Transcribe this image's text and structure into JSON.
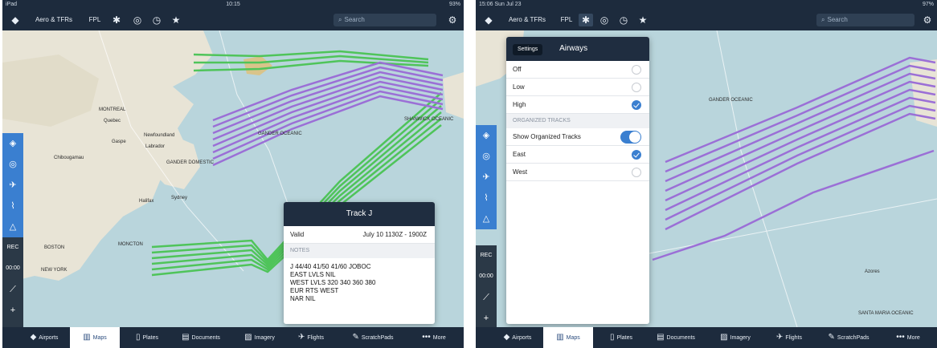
{
  "left": {
    "status": {
      "left": "iPad",
      "time": "10:15",
      "right": "93%"
    },
    "toolbar": {
      "layer_label": "Aero & TFRs",
      "fpl_label": "FPL",
      "search_placeholder": "Search"
    },
    "map_labels": [
      "MONTREAL",
      "Quebec",
      "Newfoundland",
      "Labrador",
      "GANDER DOMESTIC",
      "GANDER OCEANIC",
      "SHANWICK OCEANIC",
      "MONCTON",
      "BOSTON",
      "NEW YORK",
      "Chibougamau",
      "Gaspe",
      "Sydney",
      "Halifax"
    ],
    "side_labels": {
      "rec": "REC",
      "timer": "00:00"
    },
    "popup": {
      "title": "Track J",
      "valid_label": "Valid",
      "valid_value": "July 10 1130Z - 1900Z",
      "notes_header": "NOTES",
      "notes": [
        "J 44/40 41/50 41/60 JOBOC",
        "EAST LVLS NIL",
        "WEST LVLS 320 340 360 380",
        "EUR RTS WEST",
        "NAR NIL"
      ]
    },
    "tabs": [
      "Airports",
      "Maps",
      "Plates",
      "Documents",
      "Imagery",
      "Flights",
      "ScratchPads",
      "More"
    ],
    "active_tab": "Maps"
  },
  "right": {
    "status": {
      "left": "15:06 Sun Jul 23",
      "right": "97%"
    },
    "toolbar": {
      "layer_label": "Aero & TFRs",
      "fpl_label": "FPL",
      "search_placeholder": "Search"
    },
    "map_labels": [
      "GANDER OCEANIC",
      "SANTA MARIA OCEANIC",
      "Azores"
    ],
    "side_labels": {
      "rec": "REC",
      "timer": "00:00"
    },
    "settings": {
      "back_label": "Settings",
      "title": "Airways",
      "options": [
        {
          "label": "Off",
          "selected": false
        },
        {
          "label": "Low",
          "selected": false
        },
        {
          "label": "High",
          "selected": true
        }
      ],
      "tracks_header": "ORGANIZED TRACKS",
      "show_tracks_label": "Show Organized Tracks",
      "show_tracks_on": true,
      "directions": [
        {
          "label": "East",
          "selected": true
        },
        {
          "label": "West",
          "selected": false
        }
      ]
    },
    "tabs": [
      "Airports",
      "Maps",
      "Plates",
      "Documents",
      "Imagery",
      "Flights",
      "ScratchPads",
      "More"
    ],
    "active_tab": "Maps"
  },
  "colors": {
    "nav": "#1d2b3d",
    "accent": "#3a7fd0",
    "track_east": "#9b6fd6",
    "track_west": "#4fc45a",
    "ocean": "#b9d5dc",
    "land": "#e8e4d6"
  },
  "icons": {
    "toolbar": [
      "globe-icon",
      "gear-icon",
      "compass-icon",
      "clock-icon",
      "star-icon",
      "settings-icon"
    ],
    "tabs": [
      "airport-icon",
      "map-icon",
      "plate-icon",
      "document-icon",
      "imagery-icon",
      "flight-icon",
      "pencil-icon",
      "more-icon"
    ]
  }
}
